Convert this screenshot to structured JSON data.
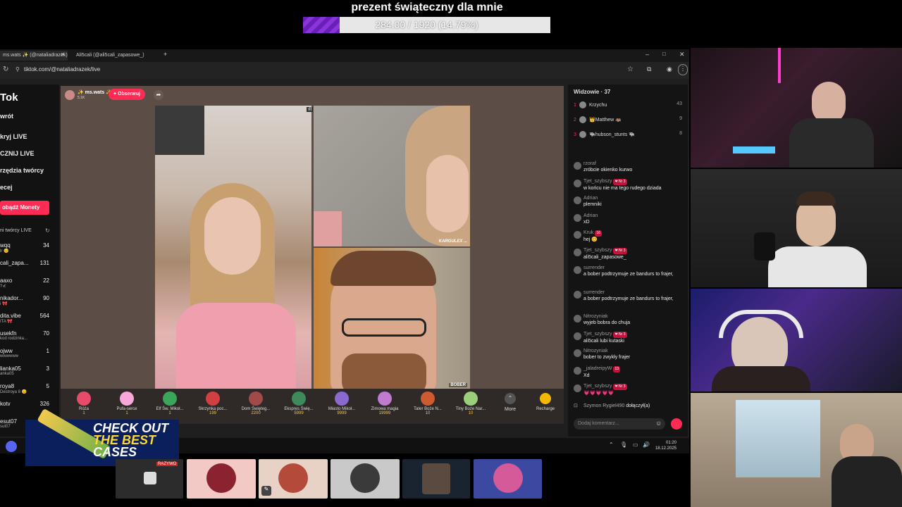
{
  "goal": {
    "title": "prezent świąteczny dla mnie",
    "progress_text": "284.00 / 1920 (14.79%)",
    "fraction": 0.1479
  },
  "browser": {
    "tabs": [
      {
        "label": "ms.wats ✨ (@nataliadrazek)"
      },
      {
        "label": "Ali5cali (@ali5cali_zapasowe_)"
      }
    ],
    "url": "tiktok.com/@nataliadrazek/live"
  },
  "tiktok": {
    "logo": "Tok",
    "nav": [
      "wrót",
      "kryj LIVE",
      "CZNIJ LIVE",
      "rzędzia twórcy",
      "ecej"
    ],
    "coins_button": "obądź Monety",
    "suggested_header": "ni twórcy LIVE",
    "suggested": [
      {
        "name": "wqq",
        "sub": "lr 😊",
        "count": "34"
      },
      {
        "name": "cali_zapa...",
        "sub": "",
        "count": "131"
      },
      {
        "name": "aaxo",
        "sub": "?⊀",
        "count": "22"
      },
      {
        "name": "nikador...",
        "sub": "i 🎀",
        "count": "90"
      },
      {
        "name": "dita.vibe",
        "sub": "ITA 🎀",
        "count": "564"
      },
      {
        "name": "usekfn",
        "sub": "kod rodzinka...",
        "count": "70"
      },
      {
        "name": "ojww",
        "sub": "wwwwww",
        "count": "1"
      },
      {
        "name": "lianka05",
        "sub": "anka05",
        "count": "3"
      },
      {
        "name": "royа8",
        "sub": "Destroya 8 😊",
        "count": "5"
      },
      {
        "name": "kotv",
        "sub": "",
        "count": "326"
      },
      {
        "name": "esut07",
        "sub": "sut07",
        "count": ""
      }
    ]
  },
  "stream": {
    "host_name": "✨ ms.wats ✨",
    "host_likes": "5.1K",
    "follow_label": "+ Obserwuj",
    "cam_label_tr": "KARGULEX ...",
    "cam_label_br": "BOBER",
    "gifts": [
      {
        "name": "Róża",
        "price": "1",
        "color": "#e84a6c"
      },
      {
        "name": "Pufa-serce",
        "price": "1",
        "color": "#f7a8d8"
      },
      {
        "name": "Elf Św. Mikoł...",
        "price": "1",
        "color": "#3aa65a"
      },
      {
        "name": "Skrzynka poc...",
        "price": "199",
        "color": "#d04040"
      },
      {
        "name": "Dom Święteg...",
        "price": "2200",
        "color": "#a04a4a"
      },
      {
        "name": "Ekspres Świę...",
        "price": "5999",
        "color": "#3f8a5a"
      },
      {
        "name": "Miasto Mikoł...",
        "price": "9999",
        "color": "#8a6ad0"
      },
      {
        "name": "Zimowa magia",
        "price": "19999",
        "color": "#c07ad0"
      },
      {
        "name": "Tater Boże N...",
        "price": "10",
        "color": "#d05a30"
      },
      {
        "name": "Tiny Boże Nar...",
        "price": "10",
        "color": "#9ad07a"
      }
    ],
    "more_label": "More",
    "recharge_label": "Recharge"
  },
  "chat": {
    "viewers_label": "Widzowie · 37",
    "top_viewers": [
      {
        "rank": "1",
        "name": "Krzychu",
        "score": "43"
      },
      {
        "rank": "2",
        "name": "👑Matthew 🦛",
        "score": "9"
      },
      {
        "rank": "3",
        "name": "🐃hubson_stunts 🐃",
        "score": "8"
      }
    ],
    "messages": [
      {
        "user": "rzoraf",
        "text": "zróbcie okienko kurwo",
        "badge": ""
      },
      {
        "user": "Tjet_szybszy",
        "text": "w końcu nie ma tego rudego dziada",
        "badge": "❤ Nr 3"
      },
      {
        "user": "Adrian",
        "text": "plemniki",
        "badge": ""
      },
      {
        "user": "Adrian",
        "text": "xD",
        "badge": ""
      },
      {
        "user": "Kruk",
        "text": "hej 😊",
        "badge": "16"
      },
      {
        "user": "Tjet_szybszy",
        "text": "ali5cali_zapasowe_",
        "badge": "❤ Nr 3"
      },
      {
        "user": "surrender",
        "text": "a bober podtrzymuje ze bandurs to frajer,",
        "badge": ""
      },
      {
        "user": "surrender",
        "text": "a bober podtrzymuje ze bandurs to frajer,",
        "badge": ""
      },
      {
        "user": "Nitrozyniak",
        "text": "wyjeb bobra do chuja",
        "badge": ""
      },
      {
        "user": "Tjet_szybszy",
        "text": "ali5cali lubi kutaski",
        "badge": "❤ Nr 3"
      },
      {
        "user": "Nitrozyniak",
        "text": "bober to zwykły frajer",
        "badge": ""
      },
      {
        "user": "_jaladreipyW",
        "text": "Xd",
        "badge": "13"
      },
      {
        "user": "Tjet_szybszy",
        "text": "💗💗💗💗💗",
        "badge": "❤ Nr 3"
      }
    ],
    "joined_user": "Szymon Rygiel490",
    "joined_text": "dołączył(a)",
    "comment_placeholder": "Dodaj komentarz..."
  },
  "taskbar": {
    "time": "01:20",
    "date": "18.12.2025"
  },
  "ad": {
    "line1": "CHECK OUT",
    "line2": "THE BEST",
    "line3": "CASES"
  },
  "dock_overlay": "RAZYWO",
  "colors": {
    "tiktok_red": "#fe2c55",
    "stage_bg": "#5d4d47",
    "goal_purple": "#7a2ad0"
  }
}
